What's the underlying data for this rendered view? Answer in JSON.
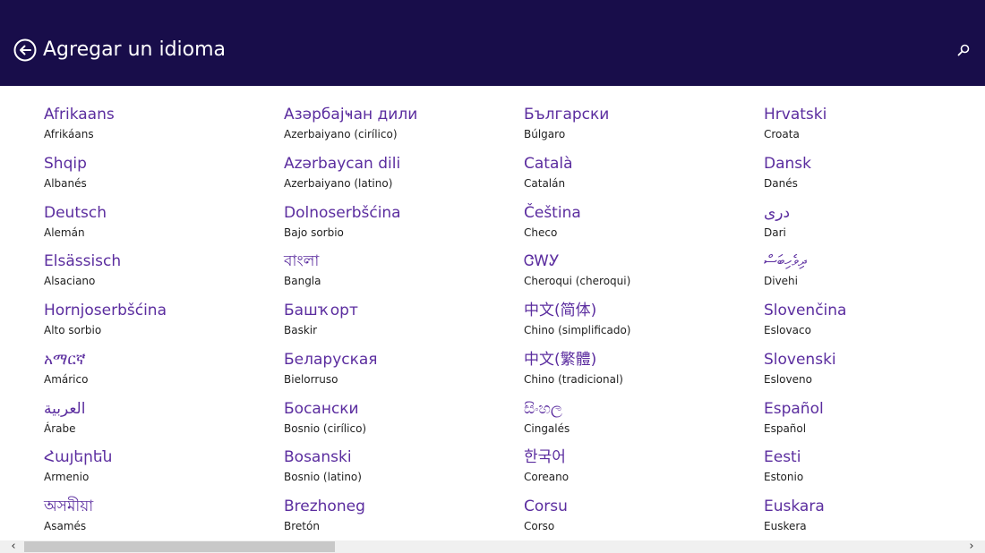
{
  "header": {
    "title": "Agregar un idioma",
    "back_icon": "back-arrow-circle-icon",
    "search_icon": "search-icon"
  },
  "languages": [
    [
      {
        "native": "Afrikaans",
        "translated": "Afrikáans"
      },
      {
        "native": "Shqip",
        "translated": "Albanés"
      },
      {
        "native": "Deutsch",
        "translated": "Alemán"
      },
      {
        "native": "Elsässisch",
        "translated": "Alsaciano"
      },
      {
        "native": "Hornjoserbšćina",
        "translated": "Alto sorbio"
      },
      {
        "native": "አማርኛ",
        "translated": "Amárico"
      },
      {
        "native": "العربية",
        "translated": "Árabe"
      },
      {
        "native": "Հայերեն",
        "translated": "Armenio"
      },
      {
        "native": "অসমীয়া",
        "translated": "Asamés"
      }
    ],
    [
      {
        "native": "Азәрбајҹан дили",
        "translated": "Azerbaiyano (cirílico)"
      },
      {
        "native": "Azərbaycan dili",
        "translated": "Azerbaiyano (latino)"
      },
      {
        "native": "Dolnoserbšćina",
        "translated": "Bajo sorbio"
      },
      {
        "native": "বাংলা",
        "translated": "Bangla"
      },
      {
        "native": "Башҡорт",
        "translated": "Baskir"
      },
      {
        "native": "Беларуская",
        "translated": "Bielorruso"
      },
      {
        "native": "Босански",
        "translated": "Bosnio (cirílico)"
      },
      {
        "native": "Bosanski",
        "translated": "Bosnio (latino)"
      },
      {
        "native": "Brezhoneg",
        "translated": "Bretón"
      }
    ],
    [
      {
        "native": "Български",
        "translated": "Búlgaro"
      },
      {
        "native": "Català",
        "translated": "Catalán"
      },
      {
        "native": "Čeština",
        "translated": "Checo"
      },
      {
        "native": "ᏣᎳᎩ",
        "translated": "Cheroqui (cheroqui)"
      },
      {
        "native": "中文(简体)",
        "translated": "Chino (simplificado)"
      },
      {
        "native": "中文(繁體)",
        "translated": "Chino (tradicional)"
      },
      {
        "native": "සිංහල",
        "translated": "Cingalés"
      },
      {
        "native": "한국어",
        "translated": "Coreano"
      },
      {
        "native": "Corsu",
        "translated": "Corso"
      }
    ],
    [
      {
        "native": "Hrvatski",
        "translated": "Croata"
      },
      {
        "native": "Dansk",
        "translated": "Danés"
      },
      {
        "native": "درى",
        "translated": "Dari"
      },
      {
        "native": "ދިވެހިބަސް",
        "translated": "Divehi"
      },
      {
        "native": "Slovenčina",
        "translated": "Eslovaco"
      },
      {
        "native": "Slovenski",
        "translated": "Esloveno"
      },
      {
        "native": "Español",
        "translated": "Español"
      },
      {
        "native": "Eesti",
        "translated": "Estonio"
      },
      {
        "native": "Euskara",
        "translated": "Euskera"
      }
    ]
  ],
  "scrollbar": {
    "left_icon": "chevron-left-icon",
    "right_icon": "chevron-right-icon",
    "left_glyph": "‹",
    "right_glyph": "›"
  },
  "colors": {
    "header_bg": "#180d4a",
    "native_text": "#5b2d9f",
    "translated_text": "#1f1f1f"
  }
}
